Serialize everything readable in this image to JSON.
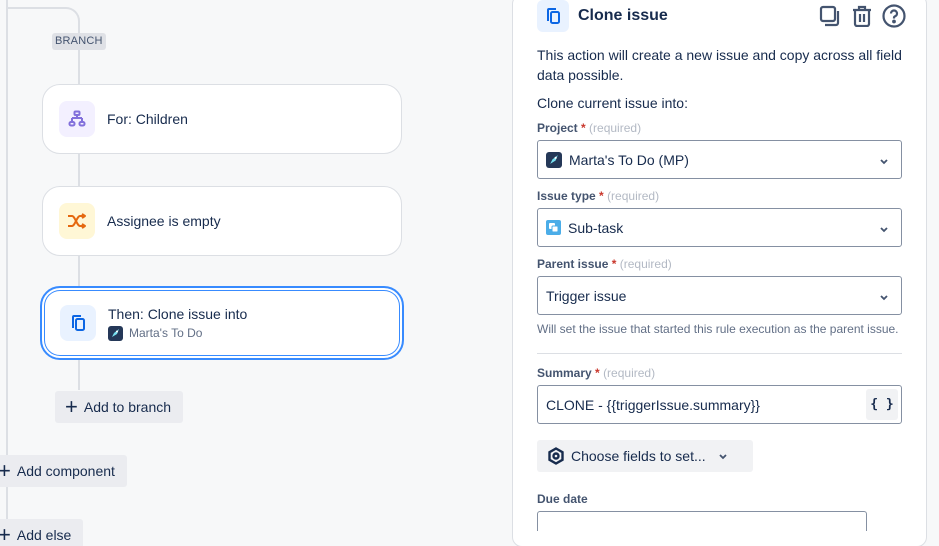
{
  "canvas": {
    "branch_tag": "BRANCH",
    "nodes": [
      {
        "title": "For: Children",
        "icon": "branch-hierarchy-icon",
        "icon_bg": "#f3f0ff",
        "icon_color": "#8270db"
      },
      {
        "title": "Assignee is empty",
        "icon": "shuffle-condition-icon",
        "icon_bg": "#fff7d6",
        "icon_color": "#e56910"
      },
      {
        "title": "Then: Clone issue into",
        "subtitle": "Marta's To Do",
        "icon": "clone-icon",
        "icon_bg": "#e9f2ff",
        "icon_color": "#0c66e4",
        "selected": true
      }
    ],
    "add_to_branch": "Add to branch",
    "add_component": "Add component",
    "add_else": "Add else"
  },
  "panel": {
    "title": "Clone issue",
    "description": "This action will create a new issue and copy across all field data possible.",
    "subdescription": "Clone current issue into:",
    "required_text": "(required)",
    "fields": {
      "project": {
        "label": "Project",
        "value": "Marta's To Do (MP)"
      },
      "issue_type": {
        "label": "Issue type",
        "value": "Sub-task"
      },
      "parent_issue": {
        "label": "Parent issue",
        "value": "Trigger issue",
        "helper": "Will set the issue that started this rule execution as the parent issue."
      },
      "summary": {
        "label": "Summary",
        "value": "CLONE - {{triggerIssue.summary}}",
        "smart_value_button": "{ }"
      },
      "due_date": {
        "label": "Due date",
        "value": ""
      }
    },
    "choose_fields": "Choose fields to set...",
    "colors": {
      "accent": "#388bff",
      "required_star": "#c9372c"
    }
  }
}
